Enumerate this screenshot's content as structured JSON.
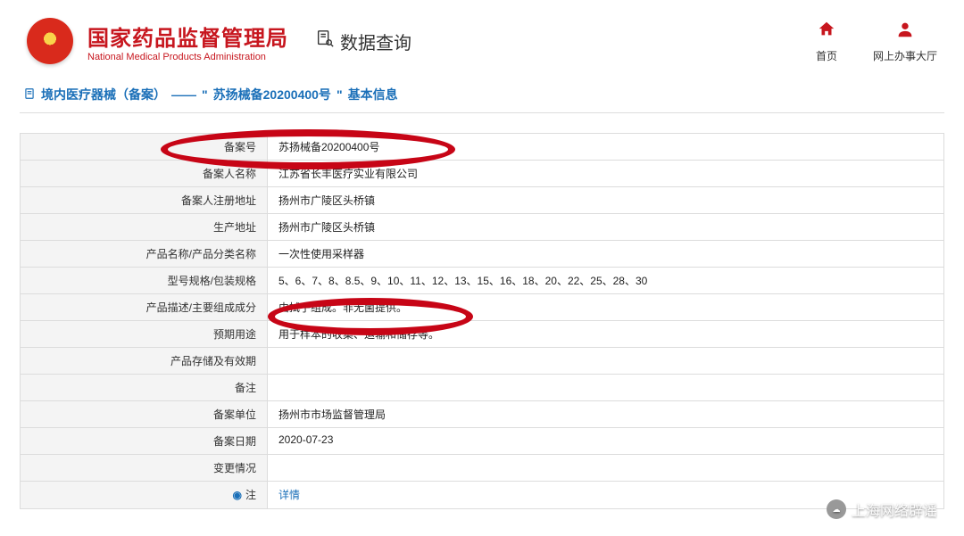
{
  "header": {
    "agency_cn": "国家药品监督管理局",
    "agency_en": "National Medical Products Administration",
    "query_label": "数据查询"
  },
  "nav": {
    "home": "首页",
    "hall": "网上办事大厅"
  },
  "breadcrumb": {
    "prefix": "境内医疗器械（备案）",
    "sep": "——",
    "quote_open": "\"",
    "record_no": "苏扬械备20200400号",
    "quote_close": "\"",
    "suffix": "基本信息"
  },
  "rows": [
    {
      "label": "备案号",
      "value": "苏扬械备20200400号"
    },
    {
      "label": "备案人名称",
      "value": "江苏省长丰医疗实业有限公司"
    },
    {
      "label": "备案人注册地址",
      "value": "扬州市广陵区头桥镇"
    },
    {
      "label": "生产地址",
      "value": "扬州市广陵区头桥镇"
    },
    {
      "label": "产品名称/产品分类名称",
      "value": "一次性使用采样器"
    },
    {
      "label": "型号规格/包装规格",
      "value": "5、6、7、8、8.5、9、10、11、12、13、15、16、18、20、22、25、28、30"
    },
    {
      "label": "产品描述/主要组成成分",
      "value": "由拭子组成。非无菌提供。"
    },
    {
      "label": "预期用途",
      "value": "用于样本的收集、运输和储存等。"
    },
    {
      "label": "产品存储及有效期",
      "value": ""
    },
    {
      "label": "备注",
      "value": ""
    },
    {
      "label": "备案单位",
      "value": "扬州市市场监督管理局"
    },
    {
      "label": "备案日期",
      "value": "2020-07-23"
    },
    {
      "label": "变更情况",
      "value": ""
    }
  ],
  "note_row": {
    "label": "注",
    "value": "详情"
  },
  "watermark": "上海网络辟谣"
}
